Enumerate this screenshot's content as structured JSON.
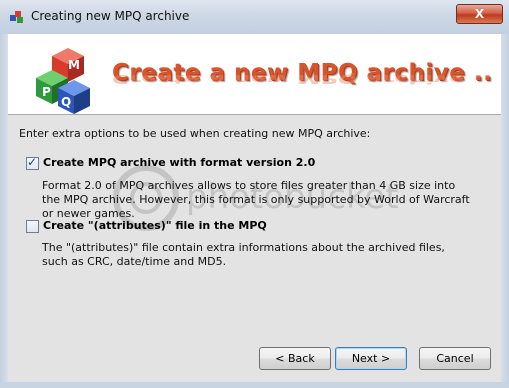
{
  "window": {
    "title": "Creating new MPQ archive",
    "close_label": "X",
    "app_icon": "mpq-editor-icon"
  },
  "header": {
    "title": "Create a new MPQ archive ..",
    "logo_letters": [
      "M",
      "P",
      "Q"
    ],
    "logo_colors": [
      "#d83a2b",
      "#2f9a3b",
      "#2c57b8"
    ],
    "title_color": "#d9542a"
  },
  "panel": {
    "intro": "Enter extra options to be used when creating new MPQ archive:",
    "options": [
      {
        "label": "Create MPQ archive with format version 2.0",
        "checked": true,
        "description": "Format 2.0 of MPQ archives allows to store files greater than 4 GB size into the MPQ archive. However, this format is only supported by World of Warcraft or newer games."
      },
      {
        "label": "Create \"(attributes)\" file in the MPQ",
        "checked": false,
        "description": "The \"(attributes)\" file contain extra informations about the archived files, such as CRC, date/time and MD5."
      }
    ]
  },
  "watermark": {
    "text": "photobucket"
  },
  "footer": {
    "back_label": "< Back",
    "next_label": "Next >",
    "cancel_label": "Cancel"
  }
}
